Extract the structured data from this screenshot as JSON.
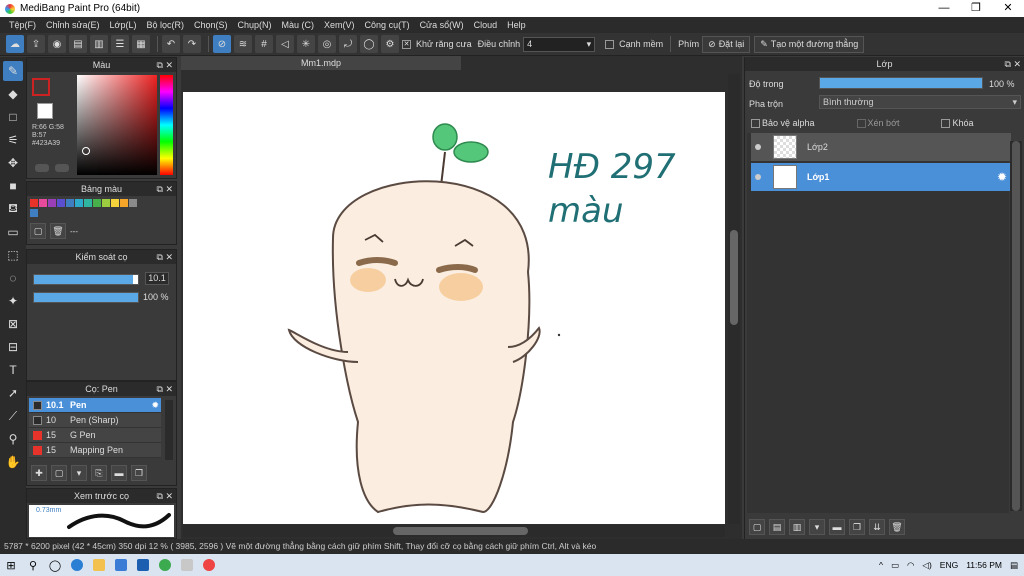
{
  "window": {
    "title": "MediBang Paint Pro (64bit)",
    "controls": [
      "—",
      "❐",
      "✕"
    ]
  },
  "menu": [
    "Tệp(F)",
    "Chỉnh sửa(E)",
    "Lớp(L)",
    "Bộ lọc(R)",
    "Chọn(S)",
    "Chụp(N)",
    "Màu (C)",
    "Xem(V)",
    "Công cụ(T)",
    "Cửa sổ(W)",
    "Cloud",
    "Help"
  ],
  "toolbar": {
    "antialias_label": "Khử răng cưa",
    "adjust_label": "Điều chỉnh",
    "adjust_value": "4",
    "edge_label": "Cạnh mềm",
    "key_label": "Phím",
    "reset_label": "Đặt lại",
    "straight_label": "Tạo một đường thẳng"
  },
  "color_panel": {
    "title": "Màu",
    "rgb_text": "R:66 G:58 B:57 #423A39",
    "primary": "#423a39"
  },
  "palette_panel": {
    "title": "Bảng màu",
    "colors": [
      "#e8332a",
      "#e94b9c",
      "#9b3fb8",
      "#5a4fcf",
      "#3f7fc1",
      "#2eaacb",
      "#2fb5a0",
      "#48b04a",
      "#9ccc3f",
      "#f5d33a",
      "#f5a52a",
      "#8a8a8a",
      "#3a3a3a"
    ],
    "footer": "---"
  },
  "brush_control": {
    "title": "Kiểm soát cọ",
    "size_value": "10.1",
    "opacity_value": "100 %",
    "size_fraction": 0.95,
    "opacity_fraction": 1.0
  },
  "brush_panel": {
    "title": "Cọ: Pen",
    "items": [
      {
        "size": "10.1",
        "name": "Pen",
        "color": "#2b2b2b"
      },
      {
        "size": "10",
        "name": "Pen (Sharp)",
        "color": "#2b2b2b"
      },
      {
        "size": "15",
        "name": "G Pen",
        "color": "#e8332a"
      },
      {
        "size": "15",
        "name": "Mapping Pen",
        "color": "#e8332a"
      }
    ]
  },
  "preview_panel": {
    "title": "Xem trước cọ",
    "size_label": "0.73mm"
  },
  "canvas": {
    "tab": "Mm1.mdp",
    "handwriting_line1": "HĐ 297",
    "handwriting_line2": "màu"
  },
  "layer_panel": {
    "title": "Lớp",
    "opacity_label": "Độ trong",
    "opacity_value": "100 %",
    "opacity_fraction": 1.0,
    "blend_label": "Pha trộn",
    "blend_value": "Bình thường",
    "protect_alpha": "Bảo vệ alpha",
    "clipping": "Xén bớt",
    "lock": "Khóa",
    "layers": [
      {
        "name": "Lớp2",
        "active": false
      },
      {
        "name": "Lớp1",
        "active": true
      }
    ]
  },
  "status": {
    "text": "5787 * 6200 pixel   (42 * 45cm)   350 dpi   12 %   ( 3985, 2596 )   Vẽ một đường thẳng bằng cách giữ phím Shift, Thay đổi cỡ cọ bằng cách giữ phím Ctrl, Alt và kéo"
  },
  "taskbar": {
    "lang": "ENG",
    "time": "11:56 PM"
  }
}
